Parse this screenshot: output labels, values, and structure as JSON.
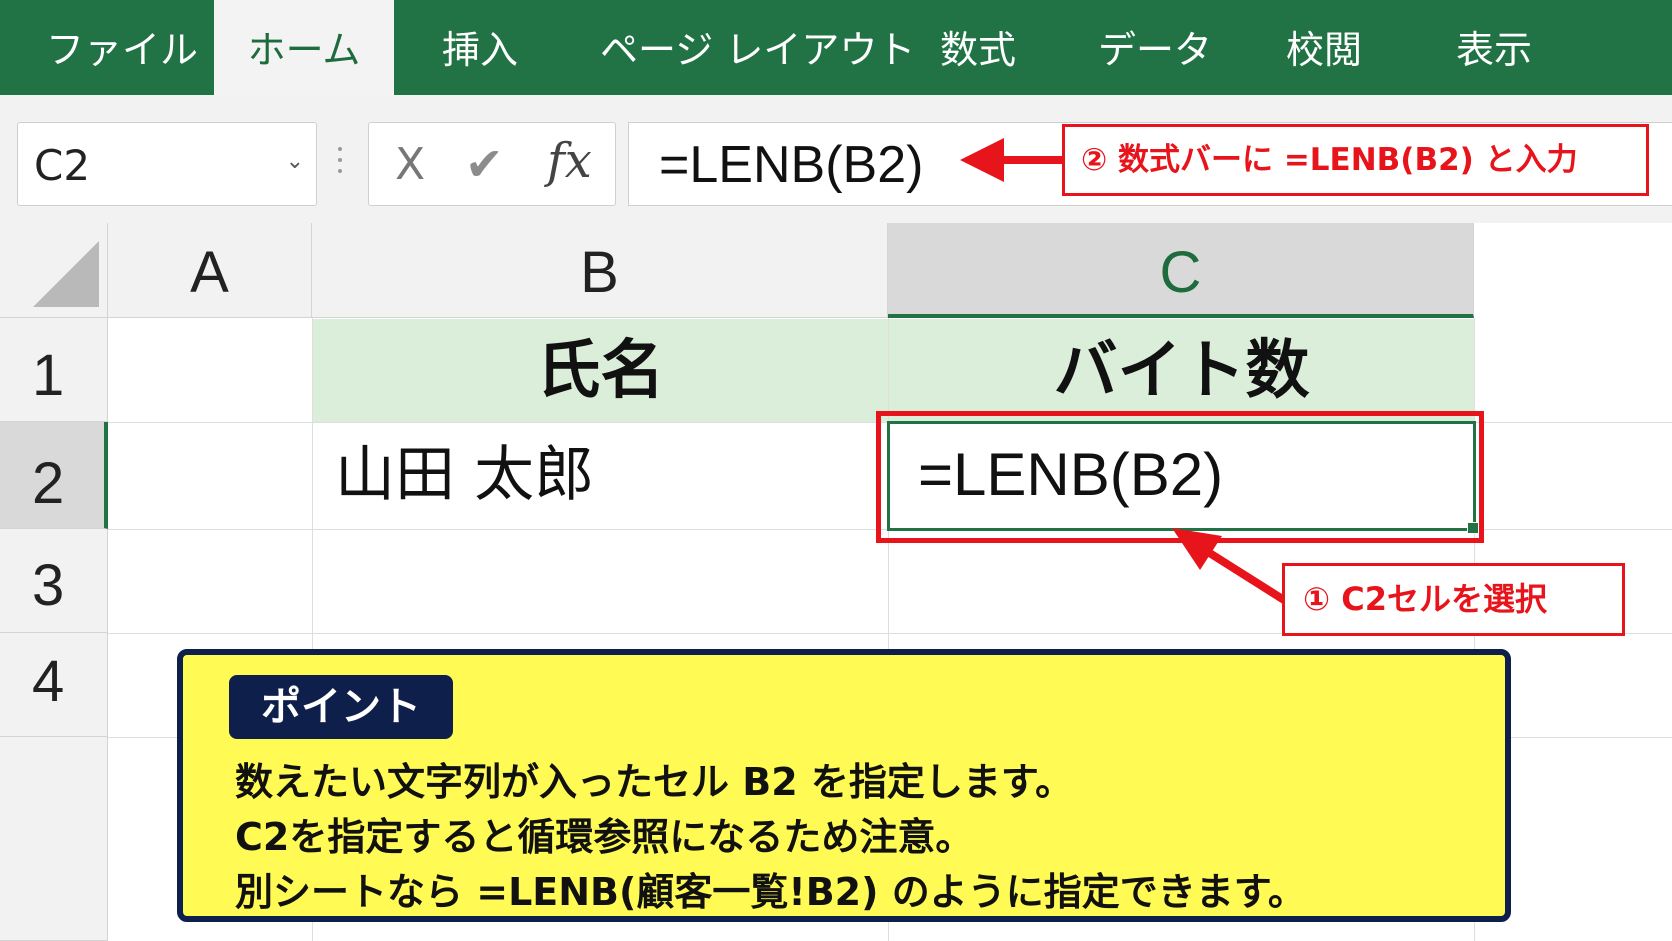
{
  "ribbon": {
    "tabs": [
      "ファイル",
      "ホーム",
      "挿入",
      "ページ レイアウト",
      "数式",
      "データ",
      "校閲",
      "表示"
    ],
    "active_tab": "ホーム"
  },
  "formula_bar": {
    "name_box": "C2",
    "cancel_glyph": "X",
    "enter_glyph": "✔",
    "fx_label": "fx",
    "formula": "=LENB(B2)"
  },
  "callouts": {
    "step2": "② 数式バーに =LENB(B2) と入力",
    "step1": "① C2セルを選択"
  },
  "grid": {
    "columns": [
      "A",
      "B",
      "C"
    ],
    "selected_column": "C",
    "rows": [
      "1",
      "2",
      "3",
      "4"
    ],
    "selected_row": "2",
    "B1": "氏名",
    "C1": "バイト数",
    "B2": "山田 太郎",
    "C2": "=LENB(B2)"
  },
  "point": {
    "badge": "ポイント",
    "lines": [
      "数えたい文字列が入ったセル B2 を指定します。",
      "C2を指定すると循環参照になるため注意。",
      "別シートなら =LENB(顧客一覧!B2) のように指定できます。"
    ]
  },
  "colors": {
    "ribbon_green": "#217346",
    "header_fill": "#dbeed9",
    "callout_red": "#e8141b",
    "point_yellow": "#fffb54",
    "point_navy": "#0e1f4b"
  }
}
